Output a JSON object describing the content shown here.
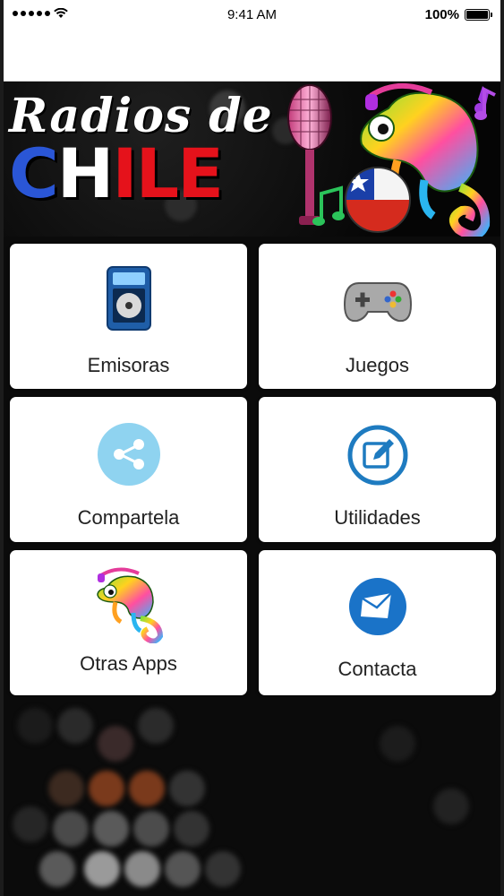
{
  "status_bar": {
    "time": "9:41 AM",
    "battery": "100%",
    "signal_icon": "signal-dots-icon",
    "wifi_icon": "wifi-icon",
    "battery_icon": "battery-icon"
  },
  "banner": {
    "title_line1": "Radios de",
    "title_line2_parts": [
      "C",
      "H",
      "ILE"
    ],
    "colors": {
      "blue": "#2a56d6",
      "white": "#ffffff",
      "red": "#e5121b"
    }
  },
  "menu": {
    "items": [
      {
        "label": "Emisoras",
        "icon": "radio-player-icon"
      },
      {
        "label": "Juegos",
        "icon": "gamepad-icon"
      },
      {
        "label": "Compartela",
        "icon": "share-icon"
      },
      {
        "label": "Utilidades",
        "icon": "edit-icon"
      },
      {
        "label": "Otras Apps",
        "icon": "chameleon-icon"
      },
      {
        "label": "Contacta",
        "icon": "mail-icon"
      }
    ]
  },
  "theme": {
    "background": "#0b0b0b",
    "card": "#ffffff",
    "share_circle": "#8fd3f0",
    "edit_ring": "#1e7bc0",
    "mail_circle": "#1a73c8"
  }
}
